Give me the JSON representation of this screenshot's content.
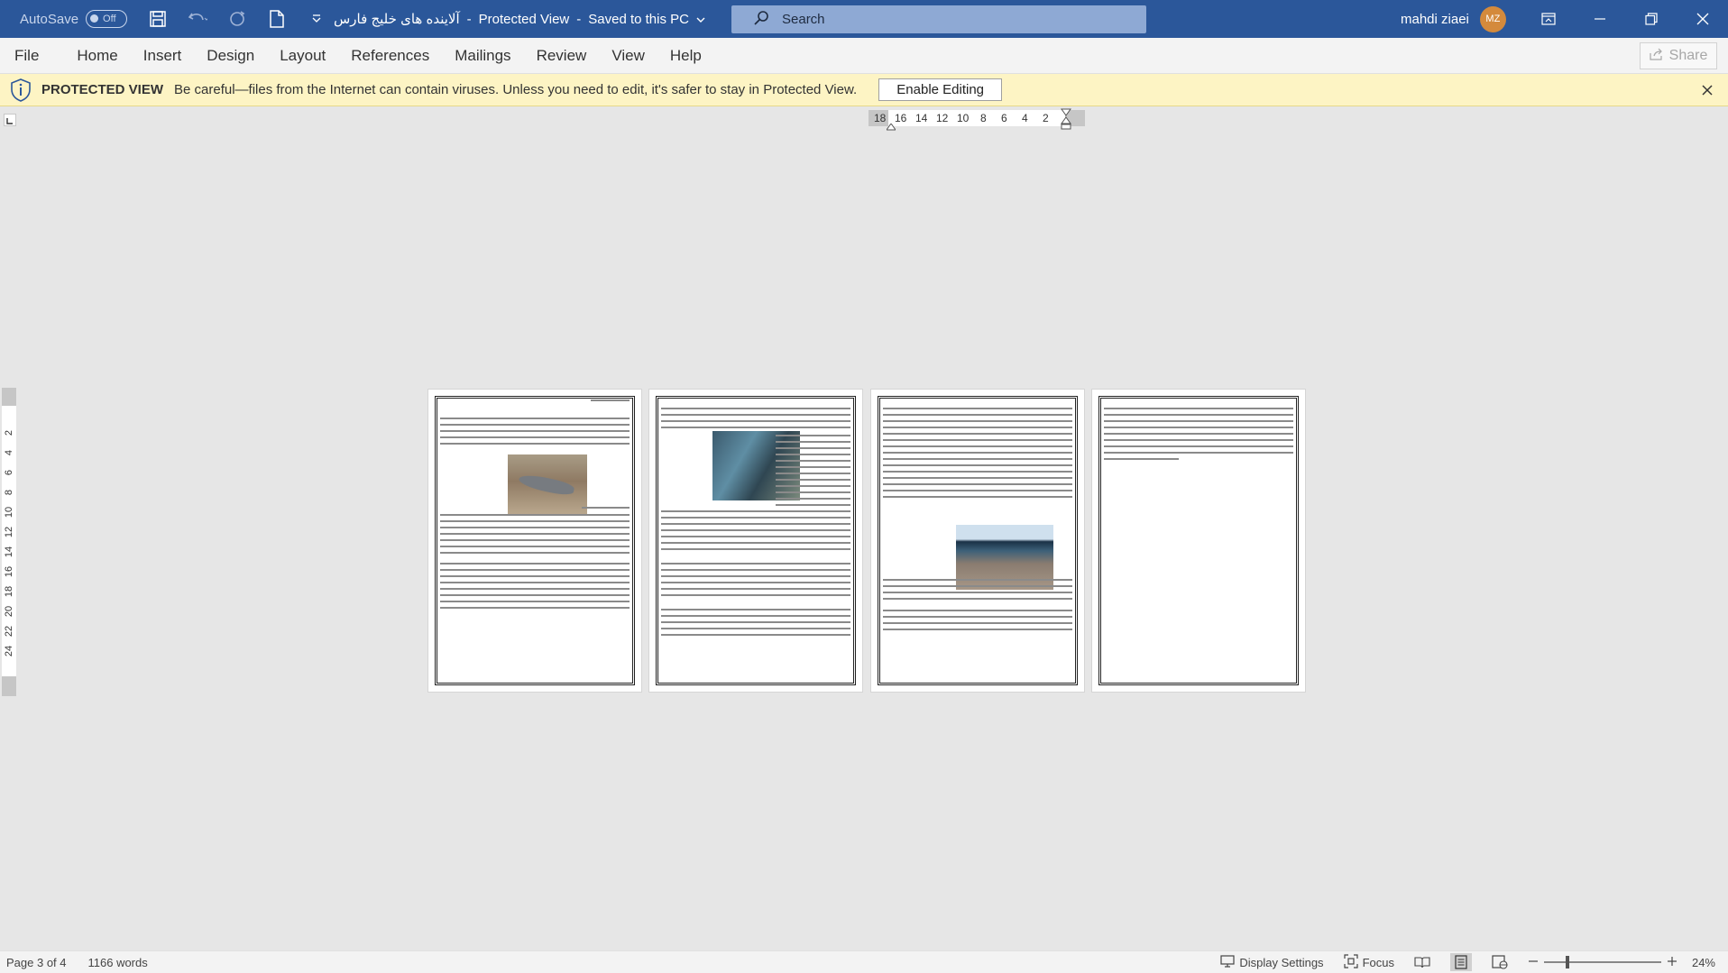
{
  "titlebar": {
    "autosave_label": "AutoSave",
    "autosave_state": "Off",
    "doc_name": "آلاینده های خلیج فارس",
    "separator": "-",
    "mode": "Protected View",
    "separator2": "-",
    "save_status": "Saved to this PC",
    "search_placeholder": "Search",
    "user_name": "mahdi ziaei",
    "user_initials": "MZ"
  },
  "menu": {
    "items": [
      "File",
      "Home",
      "Insert",
      "Design",
      "Layout",
      "References",
      "Mailings",
      "Review",
      "View",
      "Help"
    ],
    "share_label": "Share"
  },
  "protected_view": {
    "title": "PROTECTED VIEW",
    "message": "Be careful—files from the Internet can contain viruses. Unless you need to edit, it's safer to stay in Protected View.",
    "button": "Enable Editing"
  },
  "ruler": {
    "h_numbers": [
      "18",
      "16",
      "14",
      "12",
      "10",
      "8",
      "6",
      "4",
      "2"
    ],
    "v_numbers": [
      "2",
      "4",
      "6",
      "8",
      "10",
      "12",
      "14",
      "16",
      "18",
      "20",
      "22",
      "24"
    ]
  },
  "status": {
    "page": "Page 3 of 4",
    "words": "1166 words",
    "display_settings": "Display Settings",
    "focus": "Focus",
    "zoom": "24%"
  },
  "colors": {
    "title_bar": "#2b579a",
    "protected_bar": "#fdf4c4",
    "canvas": "#e6e6e6"
  }
}
